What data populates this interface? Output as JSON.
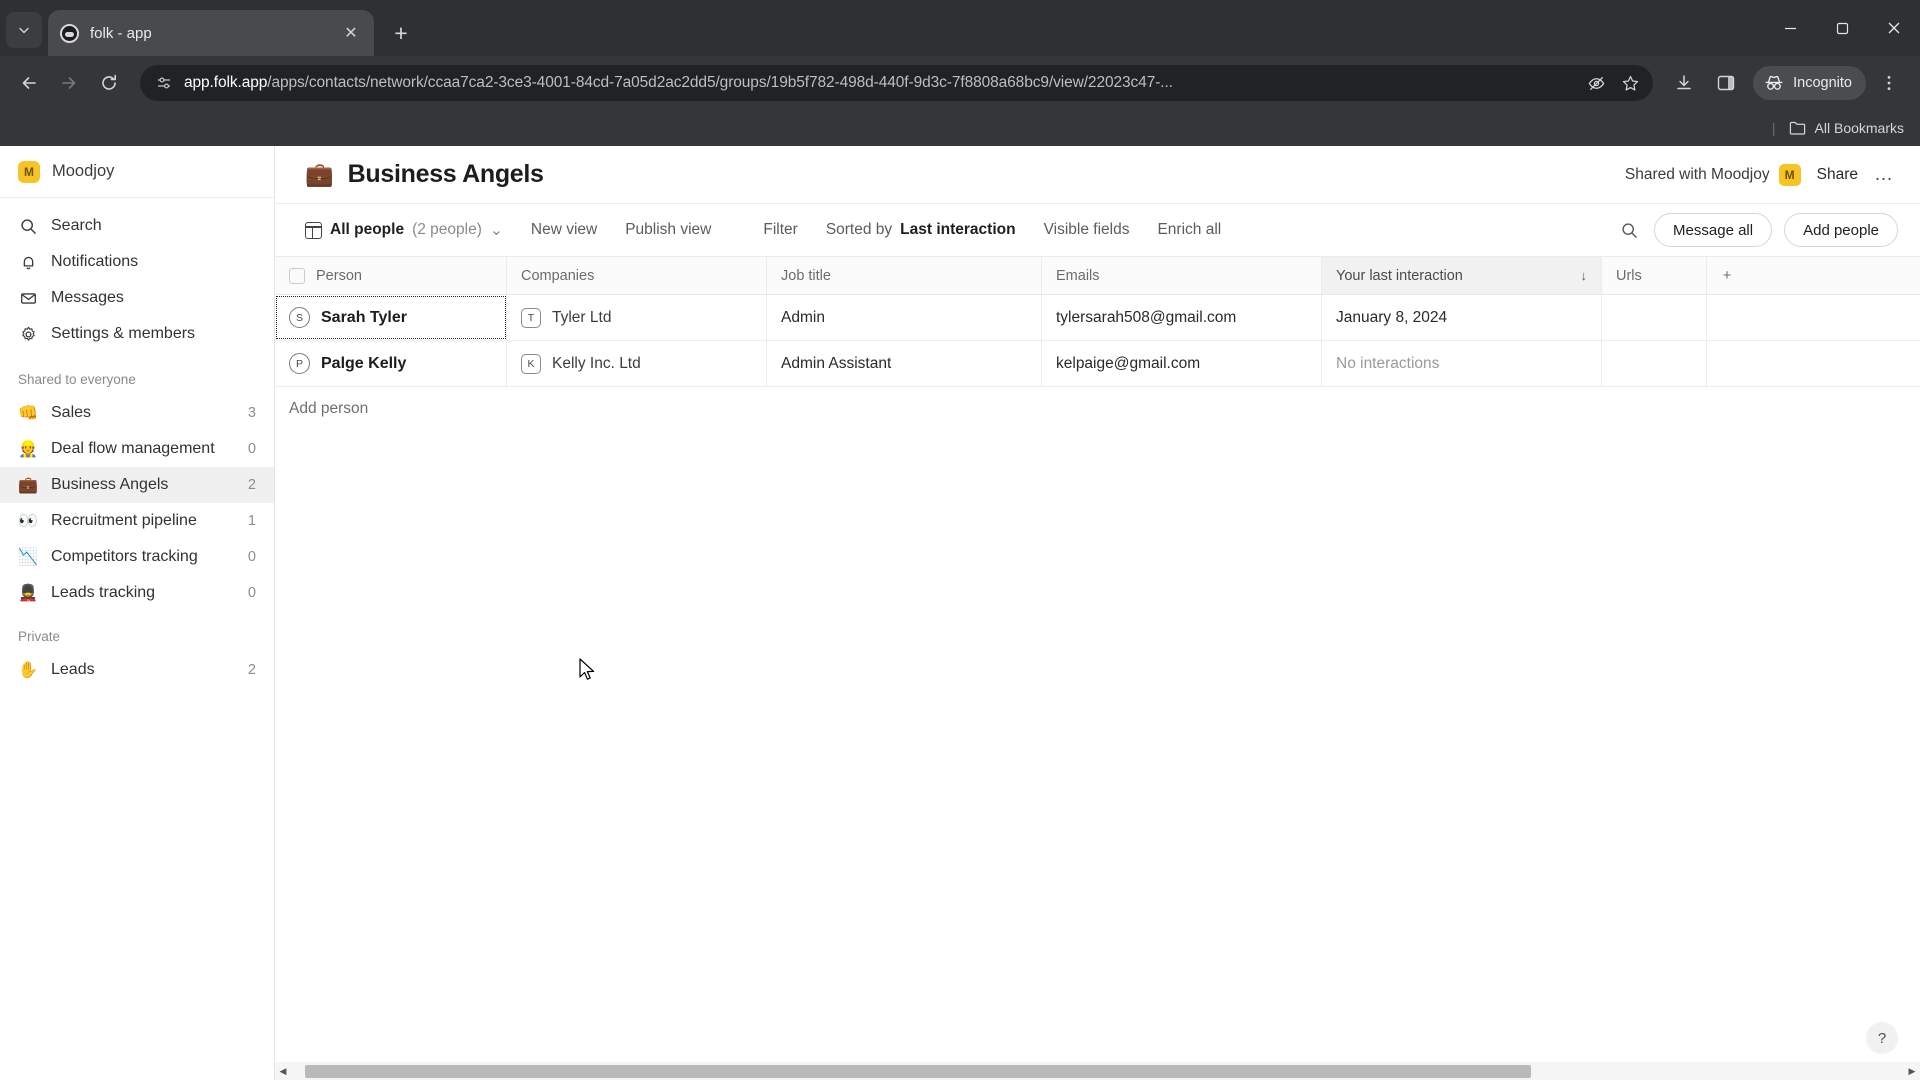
{
  "browser": {
    "tab": {
      "title": "folk - app",
      "favicon": "folk-favicon-icon",
      "close_label": "✕"
    },
    "tab_list_label": "⌄",
    "new_tab_label": "+",
    "window_controls": {
      "minimize": "—",
      "maximize": "❐",
      "close": "✕"
    },
    "nav": {
      "back": "←",
      "forward": "→",
      "reload": "↻"
    },
    "url": {
      "host": "app.folk.app",
      "path": "/apps/contacts/network/ccaa7ca2-3ce3-4001-84cd-7a05d2ac2dd5/groups/19b5f782-498d-440f-9d3c-7f8808a68bc9/view/22023c47-...",
      "full": "app.folk.app/apps/contacts/network/ccaa7ca2-3ce3-4001-84cd-7a05d2ac2dd5/groups/19b5f782-498d-440f-9d3c-7f8808a68bc9/view/22023c47-..."
    },
    "incognito_label": "Incognito",
    "bookmarks_bar": {
      "all_bookmarks": "All Bookmarks"
    }
  },
  "sidebar": {
    "workspace": {
      "initial": "M",
      "name": "Moodjoy"
    },
    "nav_items": [
      {
        "icon": "search-icon",
        "label": "Search"
      },
      {
        "icon": "bell-icon",
        "label": "Notifications"
      },
      {
        "icon": "envelope-icon",
        "label": "Messages"
      },
      {
        "icon": "gear-icon",
        "label": "Settings & members"
      }
    ],
    "shared_section": {
      "title": "Shared to everyone",
      "items": [
        {
          "emoji": "👊",
          "label": "Sales",
          "count": "3",
          "active": false
        },
        {
          "emoji": "👷",
          "label": "Deal flow management",
          "count": "0",
          "active": false
        },
        {
          "emoji": "💼",
          "label": "Business Angels",
          "count": "2",
          "active": true
        },
        {
          "emoji": "👀",
          "label": "Recruitment pipeline",
          "count": "1",
          "active": false
        },
        {
          "emoji": "📉",
          "label": "Competitors tracking",
          "count": "0",
          "active": false
        },
        {
          "emoji": "💂",
          "label": "Leads tracking",
          "count": "0",
          "active": false
        }
      ]
    },
    "private_section": {
      "title": "Private",
      "items": [
        {
          "emoji": "✋",
          "label": "Leads",
          "count": "2",
          "active": false
        }
      ]
    }
  },
  "header": {
    "emoji": "💼",
    "title": "Business Angels",
    "shared_with": "Shared with Moodjoy",
    "shared_avatar_initial": "M",
    "share_label": "Share",
    "more_label": "…"
  },
  "toolbar": {
    "view_name": "All people",
    "view_count": "(2 people)",
    "chevron": "⌄",
    "new_view": "New view",
    "publish_view": "Publish view",
    "filter": "Filter",
    "sorted_by_prefix": "Sorted by",
    "sorted_by_field": "Last interaction",
    "visible_fields": "Visible fields",
    "enrich_all": "Enrich all",
    "search_icon": "search-icon",
    "message_all": "Message all",
    "add_people": "Add people"
  },
  "table": {
    "columns": [
      {
        "key": "person",
        "label": "Person"
      },
      {
        "key": "companies",
        "label": "Companies"
      },
      {
        "key": "job",
        "label": "Job title"
      },
      {
        "key": "emails",
        "label": "Emails"
      },
      {
        "key": "interaction",
        "label": "Your last interaction",
        "sorted": true,
        "sort_arrow": "↓"
      },
      {
        "key": "urls",
        "label": "Urls"
      }
    ],
    "add_column_label": "+",
    "rows": [
      {
        "avatar": "S",
        "person": "Sarah Tyler",
        "company_avatar": "T",
        "company": "Tyler Ltd",
        "job": "Admin",
        "email": "tylersarah508@gmail.com",
        "interaction": "January 8, 2024",
        "interaction_muted": false,
        "urls": "",
        "selected": true
      },
      {
        "avatar": "P",
        "person": "Palge Kelly",
        "company_avatar": "K",
        "company": "Kelly Inc. Ltd",
        "job": "Admin Assistant",
        "email": "kelpaige@gmail.com",
        "interaction": "No interactions",
        "interaction_muted": true,
        "urls": "",
        "selected": false
      }
    ],
    "add_person_label": "Add person"
  },
  "help_label": "?",
  "scrollbar": {
    "left_arrow": "◀",
    "right_arrow": "▶"
  },
  "colors": {
    "accent": "#f7c325",
    "chrome_bg": "#35363a",
    "active_row": "#f0f0f0"
  }
}
